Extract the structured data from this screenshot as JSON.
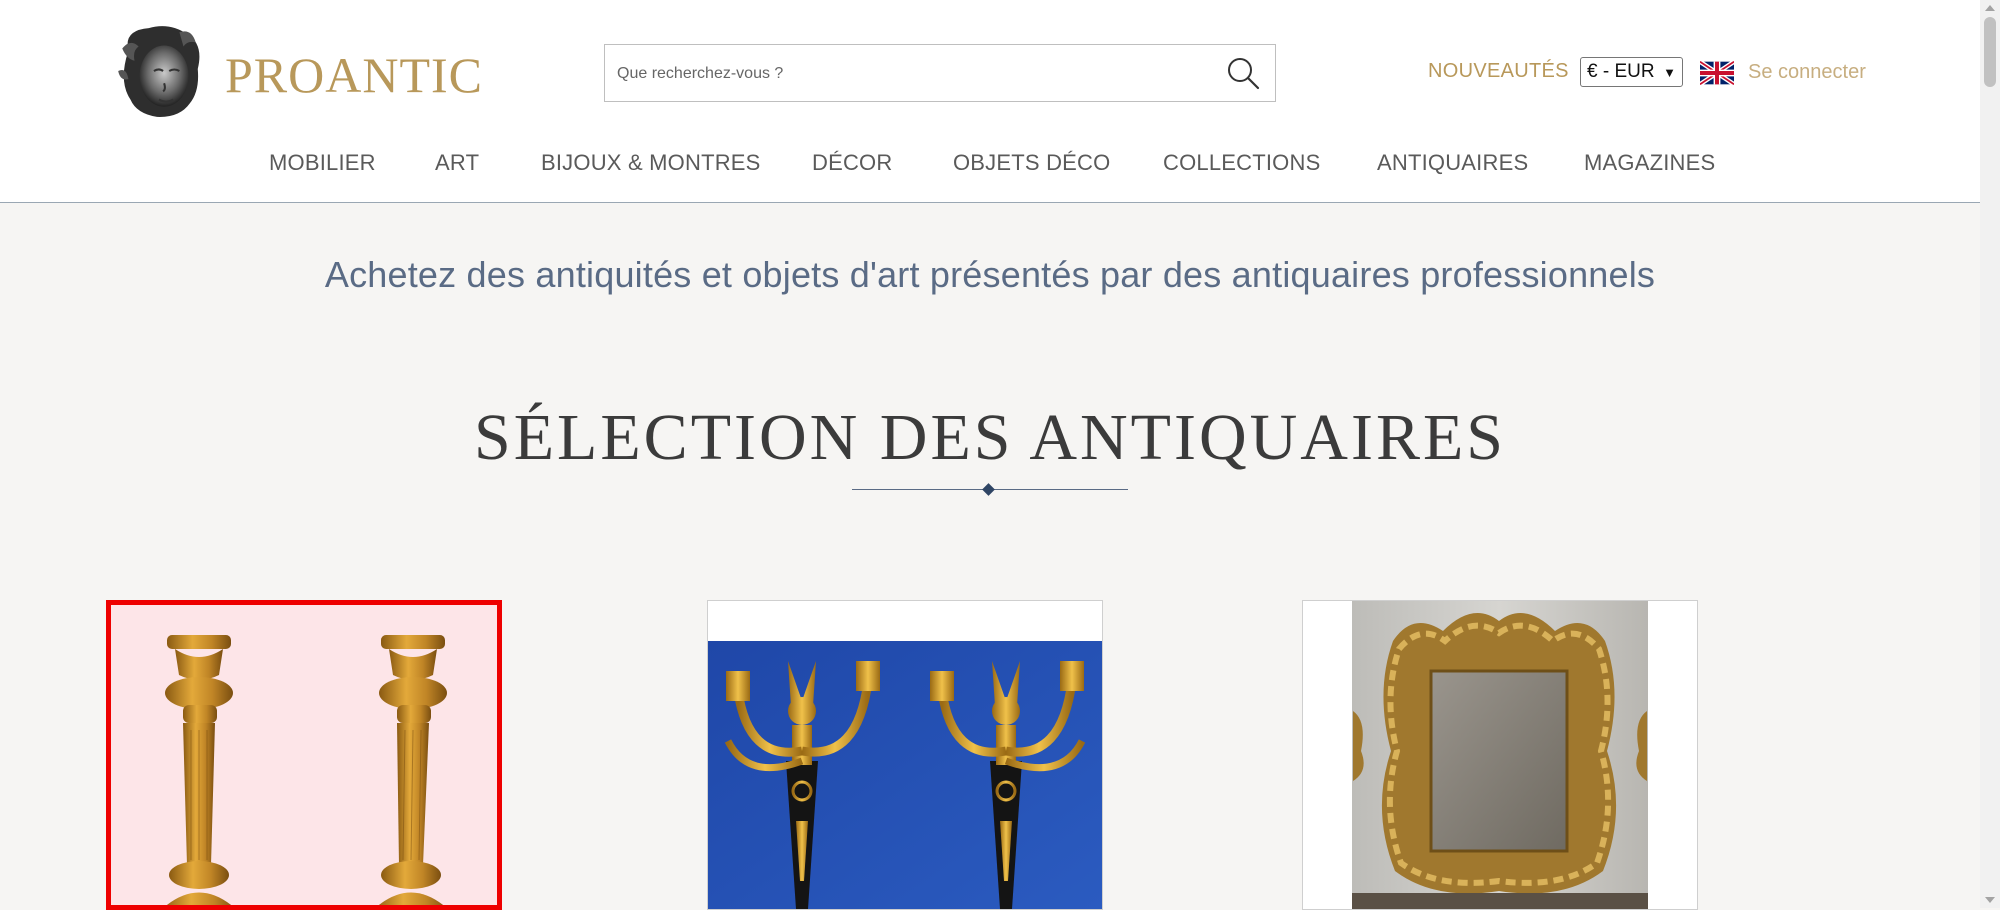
{
  "header": {
    "logo_text": "PROANTIC",
    "search": {
      "placeholder": "Que recherchez-vous ?",
      "value": ""
    },
    "nouveautes_label": "NOUVEAUTÉS",
    "currency": {
      "selected": "€ - EUR"
    },
    "language_flag": "uk-flag-icon",
    "login_label": "Se connecter"
  },
  "nav": {
    "items": [
      {
        "label": "MOBILIER"
      },
      {
        "label": "ART"
      },
      {
        "label": "BIJOUX & MONTRES"
      },
      {
        "label": "DÉCOR"
      },
      {
        "label": "OBJETS DÉCO"
      },
      {
        "label": "COLLECTIONS"
      },
      {
        "label": "ANTIQUAIRES"
      },
      {
        "label": "MAGAZINES"
      }
    ]
  },
  "main": {
    "tagline": "Achetez des antiquités et objets d'art présentés par des antiquaires professionnels",
    "section_title": "SÉLECTION DES ANTIQUAIRES",
    "products": [
      {
        "image": "gilt-bronze-candlesticks-pair",
        "selected": true
      },
      {
        "image": "empire-gilt-bronze-wall-sconces-pair",
        "selected": false
      },
      {
        "image": "carved-giltwood-mirror",
        "selected": false
      }
    ]
  },
  "colors": {
    "accent_gold": "#b8985a",
    "tagline_blue": "#5a6b85",
    "selection_red": "#ee0000",
    "background": "#f6f5f3"
  }
}
